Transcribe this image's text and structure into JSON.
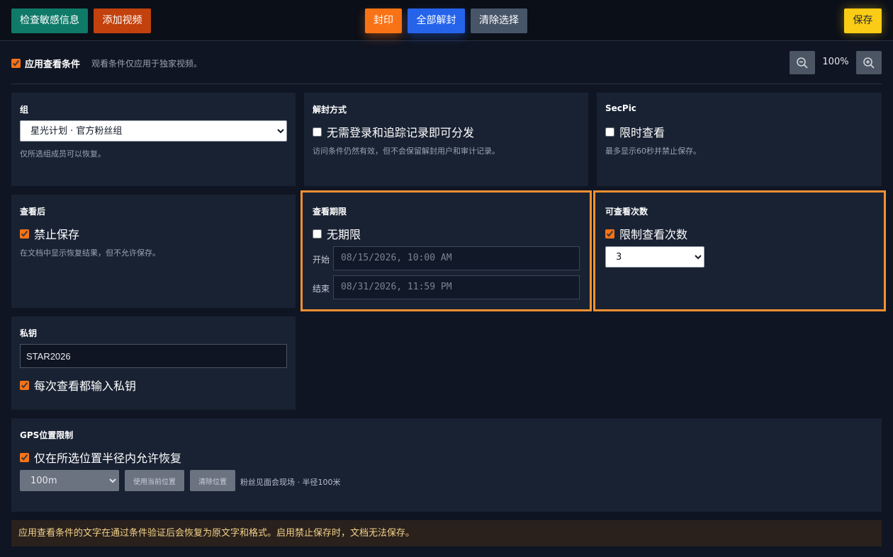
{
  "toolbar": {
    "check_sensitive": "检查敏感信息",
    "add_video": "添加视频",
    "seal": "封印",
    "unseal_all": "全部解封",
    "clear_selection": "清除选择",
    "save": "保存"
  },
  "conditions": {
    "apply_label": "应用查看条件",
    "apply_checked": true,
    "apply_desc": "观看条件仅应用于独家视频。",
    "zoom": "100%",
    "zoom_out_icon": "zoom-out-icon",
    "zoom_in_icon": "zoom-in-icon"
  },
  "group": {
    "title": "组",
    "selected": "星光计划 · 官方粉丝组",
    "hint": "仅所选组成员可以恢复。"
  },
  "unseal_method": {
    "title": "解封方式",
    "option": "无需登录和追踪记录即可分发",
    "checked": false,
    "hint": "访问条件仍然有效，但不会保留解封用户和审计记录。"
  },
  "secpic": {
    "title": "SecPic",
    "option": "限时查看",
    "checked": false,
    "hint": "最多显示60秒并禁止保存。"
  },
  "after_view": {
    "title": "查看后",
    "option": "禁止保存",
    "checked": true,
    "hint": "在文档中显示恢复结果，但不允许保存。"
  },
  "view_period": {
    "title": "查看期限",
    "option": "无期限",
    "checked": false,
    "start_label": "开始",
    "start_value": "08/15/2026, 10:00 AM",
    "end_label": "结束",
    "end_value": "08/31/2026, 11:59 PM"
  },
  "view_count": {
    "title": "可查看次数",
    "option": "限制查看次数",
    "checked": true,
    "selected": "3"
  },
  "private_key": {
    "title": "私钥",
    "value": "STAR2026",
    "option": "每次查看都输入私钥",
    "checked": true
  },
  "gps": {
    "title": "GPS位置限制",
    "option": "仅在所选位置半径内允许恢复",
    "checked": true,
    "radius": "100m",
    "use_current": "使用当前位置",
    "clear_location": "清除位置",
    "location_info": "粉丝见面会现场 · 半径100米"
  },
  "notice": "应用查看条件的文字在通过条件验证后会恢复为原文字和格式。启用禁止保存时，文档无法保存。",
  "colors": {
    "accent": "#f97316",
    "highlight_border": "#f59032",
    "save": "#facc15"
  }
}
